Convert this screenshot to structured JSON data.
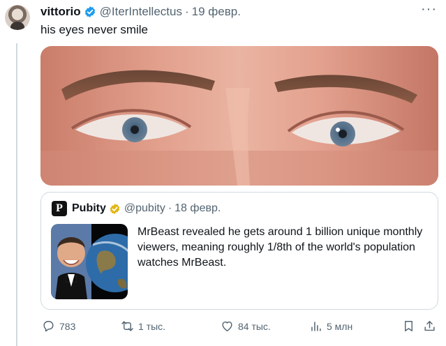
{
  "colors": {
    "verified_blue": "#1d9bf0",
    "verified_gold": "#e2b719",
    "muted_text": "#536471",
    "border": "#cfd9de"
  },
  "tweet": {
    "author_name": "vittorio",
    "author_handle": "@IterIntellectus",
    "separator": "·",
    "date": "19 февр.",
    "text": "his eyes never smile",
    "more_label": "···",
    "media": "close-up photo of a man's eyes"
  },
  "quote": {
    "logo_letter": "P",
    "author_name": "Pubity",
    "author_handle": "@pubity",
    "separator": "·",
    "date": "18 февр.",
    "text": "MrBeast revealed he gets around 1 billion unique monthly viewers, meaning roughly 1/8th of the world's population watches MrBeast."
  },
  "actions": {
    "replies": "783",
    "retweets": "1 тыс.",
    "likes": "84 тыс.",
    "views": "5 млн",
    "icons": [
      "reply-icon",
      "retweet-icon",
      "heart-icon",
      "views-icon",
      "bookmark-icon",
      "share-icon"
    ]
  }
}
